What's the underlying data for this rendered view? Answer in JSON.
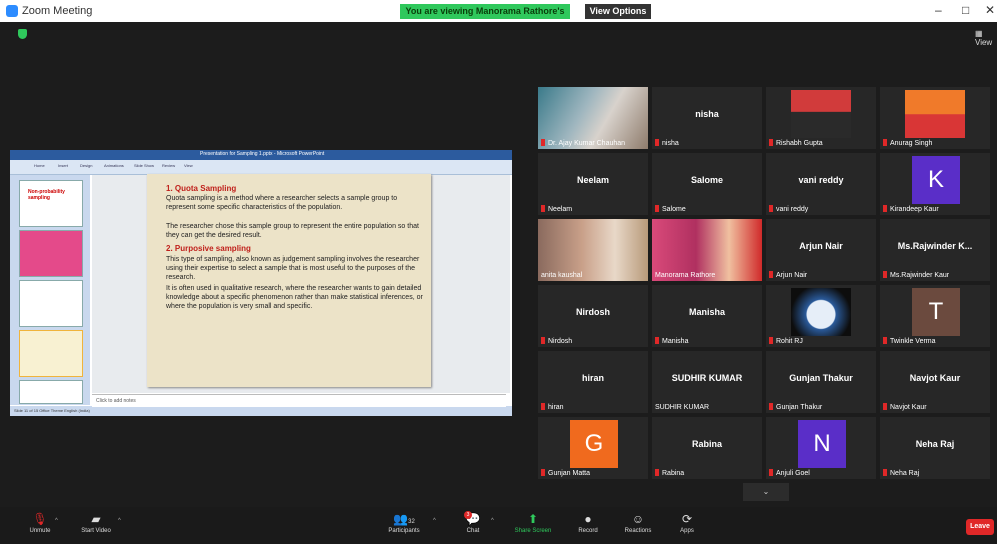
{
  "window": {
    "title": "Zoom Meeting",
    "viewing_banner": "You are viewing Manorama Rathore's screen",
    "view_options": "View Options",
    "view_label": "View",
    "controls": [
      "–",
      "□",
      "✕"
    ]
  },
  "share": {
    "pp_title": "Presentation for Sampling 1.pptx - Microsoft PowerPoint",
    "ribbon_tabs": [
      "Home",
      "Insert",
      "Design",
      "Animations",
      "Slide Show",
      "Review",
      "View"
    ],
    "thumb1_title": "Non-probability sampling",
    "notes_placeholder": "Click to add notes",
    "status": "Slide 11 of 15     Office Theme     English (India)",
    "slide": {
      "h1": "1.   Quota Sampling",
      "p1": "Quota sampling is a method where a researcher selects a sample group to represent some specific characteristics of the population.",
      "p2": "The researcher chose this sample group to represent the entire population so that they can get the desired result.",
      "h2": "2. Purposive sampling",
      "p3": "This type of sampling, also known as judgement sampling involves the researcher using their expertise to select a sample that is most useful to the purposes of the research.",
      "p4": "It is often used in qualitative research, where the researcher wants to gain detailed knowledge about a specific phenomenon rather than make statistical inferences, or where the population is very small and specific."
    }
  },
  "participants": [
    {
      "label": "Dr. Ajay Kumar Chauhan",
      "center": "",
      "muted": true
    },
    {
      "label": "nisha",
      "center": "nisha",
      "muted": true
    },
    {
      "label": "Rishabh Gupta",
      "center": "",
      "muted": true
    },
    {
      "label": "Anurag Singh",
      "center": "",
      "muted": true
    },
    {
      "label": "Neelam",
      "center": "Neelam",
      "muted": true
    },
    {
      "label": "Salome",
      "center": "Salome",
      "muted": true
    },
    {
      "label": "vani reddy",
      "center": "vani reddy",
      "muted": true
    },
    {
      "label": "Kirandeep Kaur",
      "center": "",
      "avatar": "K",
      "avatar_color": "#5a2ec8",
      "muted": true
    },
    {
      "label": "anita kaushal",
      "center": "",
      "muted": false
    },
    {
      "label": "Manorama Rathore",
      "center": "",
      "muted": false
    },
    {
      "label": "Arjun Nair",
      "center": "Arjun Nair",
      "muted": true
    },
    {
      "label": "Ms.Rajwinder Kaur",
      "center": "Ms.Rajwinder K...",
      "muted": true
    },
    {
      "label": "Nirdosh",
      "center": "Nirdosh",
      "muted": true
    },
    {
      "label": "Manisha",
      "center": "Manisha",
      "muted": true
    },
    {
      "label": "Rohit RJ",
      "center": "",
      "muted": true
    },
    {
      "label": "Twinkle Verma",
      "center": "",
      "avatar": "T",
      "avatar_color": "#6b4a3e",
      "muted": true
    },
    {
      "label": "hiran",
      "center": "hiran",
      "muted": true
    },
    {
      "label": "SUDHIR KUMAR",
      "center": "SUDHIR KUMAR",
      "muted": false
    },
    {
      "label": "Gunjan Thakur",
      "center": "Gunjan Thakur",
      "muted": true
    },
    {
      "label": "Navjot Kaur",
      "center": "Navjot Kaur",
      "muted": true
    },
    {
      "label": "Gunjan Matta",
      "center": "",
      "avatar": "G",
      "avatar_color": "#f06a1e",
      "muted": true
    },
    {
      "label": "Rabina",
      "center": "Rabina",
      "muted": true
    },
    {
      "label": "Anjuli Goel",
      "center": "",
      "avatar": "N",
      "avatar_color": "#5a2ec8",
      "muted": true
    },
    {
      "label": "Neha Raj",
      "center": "Neha Raj",
      "muted": true
    }
  ],
  "toolbar": {
    "unmute": "Unmute",
    "start_video": "Start Video",
    "participants": "Participants",
    "participants_count": "32",
    "chat": "Chat",
    "chat_badge": "3",
    "share_screen": "Share Screen",
    "record": "Record",
    "reactions": "Reactions",
    "apps": "Apps",
    "leave": "Leave"
  },
  "colors": {
    "accent_green": "#2fc85c",
    "leave_red": "#e02828",
    "active_speaker": "#b8d35a"
  }
}
